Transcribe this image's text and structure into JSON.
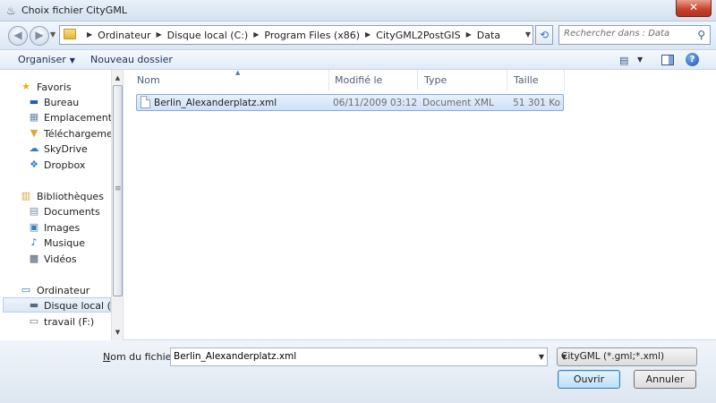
{
  "window": {
    "title": "Choix fichier CityGML",
    "close_glyph": "✕"
  },
  "address": {
    "crumbs": [
      "Ordinateur",
      "Disque local (C:)",
      "Program Files (x86)",
      "CityGML2PostGIS",
      "Data"
    ],
    "search_placeholder": "Rechercher dans : Data"
  },
  "toolbar": {
    "organize": "Organiser",
    "new_folder": "Nouveau dossier"
  },
  "nav": {
    "items": [
      {
        "label": "Favoris",
        "icon": "star-icon",
        "type": "group"
      },
      {
        "label": "Bureau",
        "icon": "desktop-icon",
        "type": "child"
      },
      {
        "label": "Emplacements récents",
        "icon": "recent-places-icon",
        "type": "child"
      },
      {
        "label": "Téléchargements",
        "icon": "downloads-icon",
        "type": "child"
      },
      {
        "label": "SkyDrive",
        "icon": "cloud-icon",
        "type": "child"
      },
      {
        "label": "Dropbox",
        "icon": "dropbox-icon",
        "type": "child"
      },
      {
        "label": "Bibliothèques",
        "icon": "libraries-icon",
        "type": "group"
      },
      {
        "label": "Documents",
        "icon": "documents-icon",
        "type": "child"
      },
      {
        "label": "Images",
        "icon": "images-icon",
        "type": "child"
      },
      {
        "label": "Musique",
        "icon": "music-icon",
        "type": "child"
      },
      {
        "label": "Vidéos",
        "icon": "videos-icon",
        "type": "child"
      },
      {
        "label": "Ordinateur",
        "icon": "computer-icon",
        "type": "group"
      },
      {
        "label": "Disque local (C:)",
        "icon": "drive-icon",
        "type": "child"
      },
      {
        "label": "travail (F:)",
        "icon": "removable-drive-icon",
        "type": "child"
      }
    ]
  },
  "columns": {
    "name": "Nom",
    "modified": "Modifié le",
    "type": "Type",
    "size": "Taille"
  },
  "files": [
    {
      "name": "Berlin_Alexanderplatz.xml",
      "modified": "06/11/2009 03:12",
      "type": "Document XML",
      "size": "51 301 Ko"
    }
  ],
  "footer": {
    "filename_label_accel": "N",
    "filename_label_rest": "om du fichier :",
    "filename_value": "Berlin_Alexanderplatz.xml",
    "filter": "CityGML (*.gml;*.xml)",
    "open": "Ouvrir",
    "cancel": "Annuler"
  }
}
